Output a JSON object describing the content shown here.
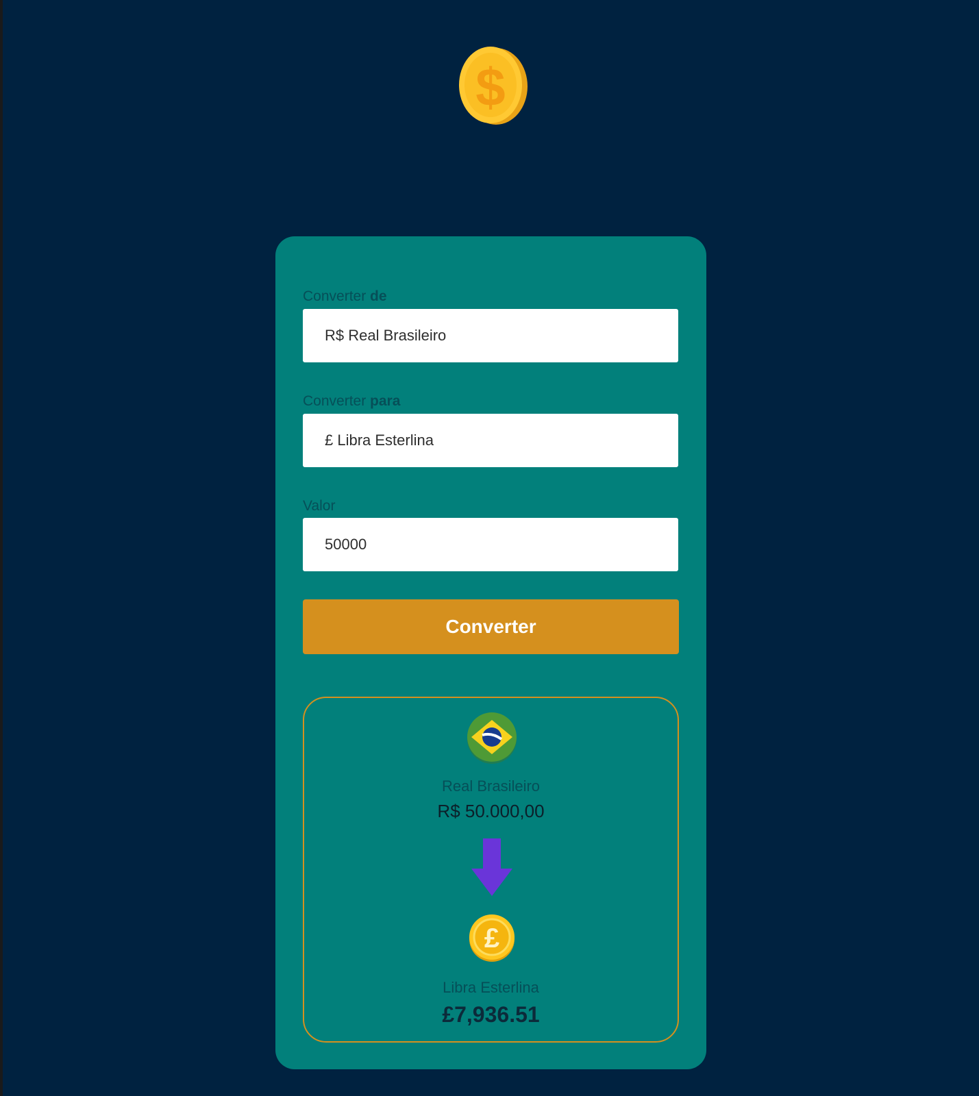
{
  "header": {
    "logo_icon": "dollar-coin-icon"
  },
  "form": {
    "from": {
      "label_prefix": "Converter",
      "label_suffix": "de",
      "value": "R$ Real Brasileiro"
    },
    "to": {
      "label_prefix": "Converter",
      "label_suffix": "para",
      "value": "£ Libra Esterlina"
    },
    "amount": {
      "label": "Valor",
      "value": "50000"
    },
    "convert_button": "Converter"
  },
  "result": {
    "from_icon": "brazil-flag-icon",
    "from_name": "Real Brasileiro",
    "from_value": "R$ 50.000,00",
    "arrow_icon": "arrow-down-icon",
    "to_icon": "pound-coin-icon",
    "to_name": "Libra Esterlina",
    "to_value": "£7,936.51"
  },
  "colors": {
    "background": "#002240",
    "card": "#02807b",
    "accent": "#d5901e",
    "arrow": "#6a35d9"
  }
}
